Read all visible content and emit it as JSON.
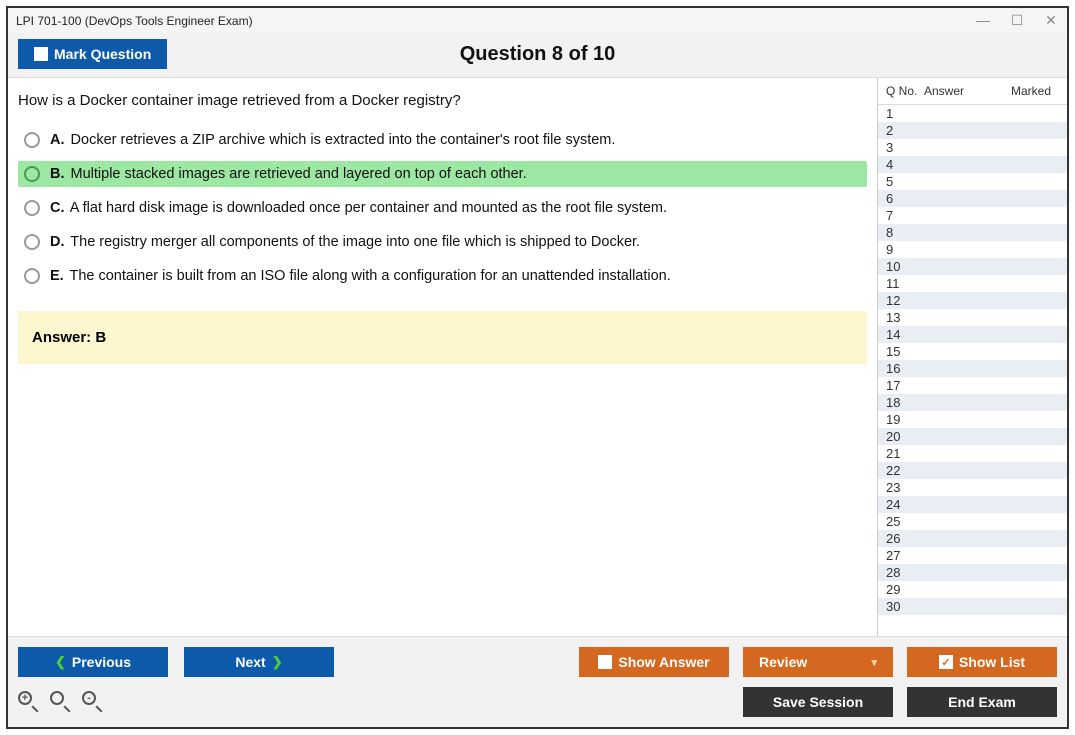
{
  "window": {
    "title": "LPI 701-100 (DevOps Tools Engineer Exam)"
  },
  "header": {
    "mark_label": "Mark Question",
    "question_title": "Question 8 of 10"
  },
  "question": {
    "text": "How is a Docker container image retrieved from a Docker registry?",
    "options": [
      {
        "letter": "A.",
        "text": "Docker retrieves a ZIP archive which is extracted into the container's root file system.",
        "highlight": false
      },
      {
        "letter": "B.",
        "text": "Multiple stacked images are retrieved and layered on top of each other.",
        "highlight": true
      },
      {
        "letter": "C.",
        "text": "A flat hard disk image is downloaded once per container and mounted as the root file system.",
        "highlight": false
      },
      {
        "letter": "D.",
        "text": "The registry merger all components of the image into one file which is shipped to Docker.",
        "highlight": false
      },
      {
        "letter": "E.",
        "text": "The container is built from an ISO file along with a configuration for an unattended installation.",
        "highlight": false
      }
    ],
    "answer_prefix": "Answer: ",
    "answer_value": "B"
  },
  "side": {
    "h_qno": "Q No.",
    "h_answer": "Answer",
    "h_marked": "Marked",
    "rows": [
      {
        "n": "1"
      },
      {
        "n": "2"
      },
      {
        "n": "3"
      },
      {
        "n": "4"
      },
      {
        "n": "5"
      },
      {
        "n": "6"
      },
      {
        "n": "7"
      },
      {
        "n": "8"
      },
      {
        "n": "9"
      },
      {
        "n": "10"
      },
      {
        "n": "11"
      },
      {
        "n": "12"
      },
      {
        "n": "13"
      },
      {
        "n": "14"
      },
      {
        "n": "15"
      },
      {
        "n": "16"
      },
      {
        "n": "17"
      },
      {
        "n": "18"
      },
      {
        "n": "19"
      },
      {
        "n": "20"
      },
      {
        "n": "21"
      },
      {
        "n": "22"
      },
      {
        "n": "23"
      },
      {
        "n": "24"
      },
      {
        "n": "25"
      },
      {
        "n": "26"
      },
      {
        "n": "27"
      },
      {
        "n": "28"
      },
      {
        "n": "29"
      },
      {
        "n": "30"
      }
    ]
  },
  "footer": {
    "previous": "Previous",
    "next": "Next",
    "show_answer": "Show Answer",
    "review": "Review",
    "show_list": "Show List",
    "save_session": "Save Session",
    "end_exam": "End Exam"
  }
}
